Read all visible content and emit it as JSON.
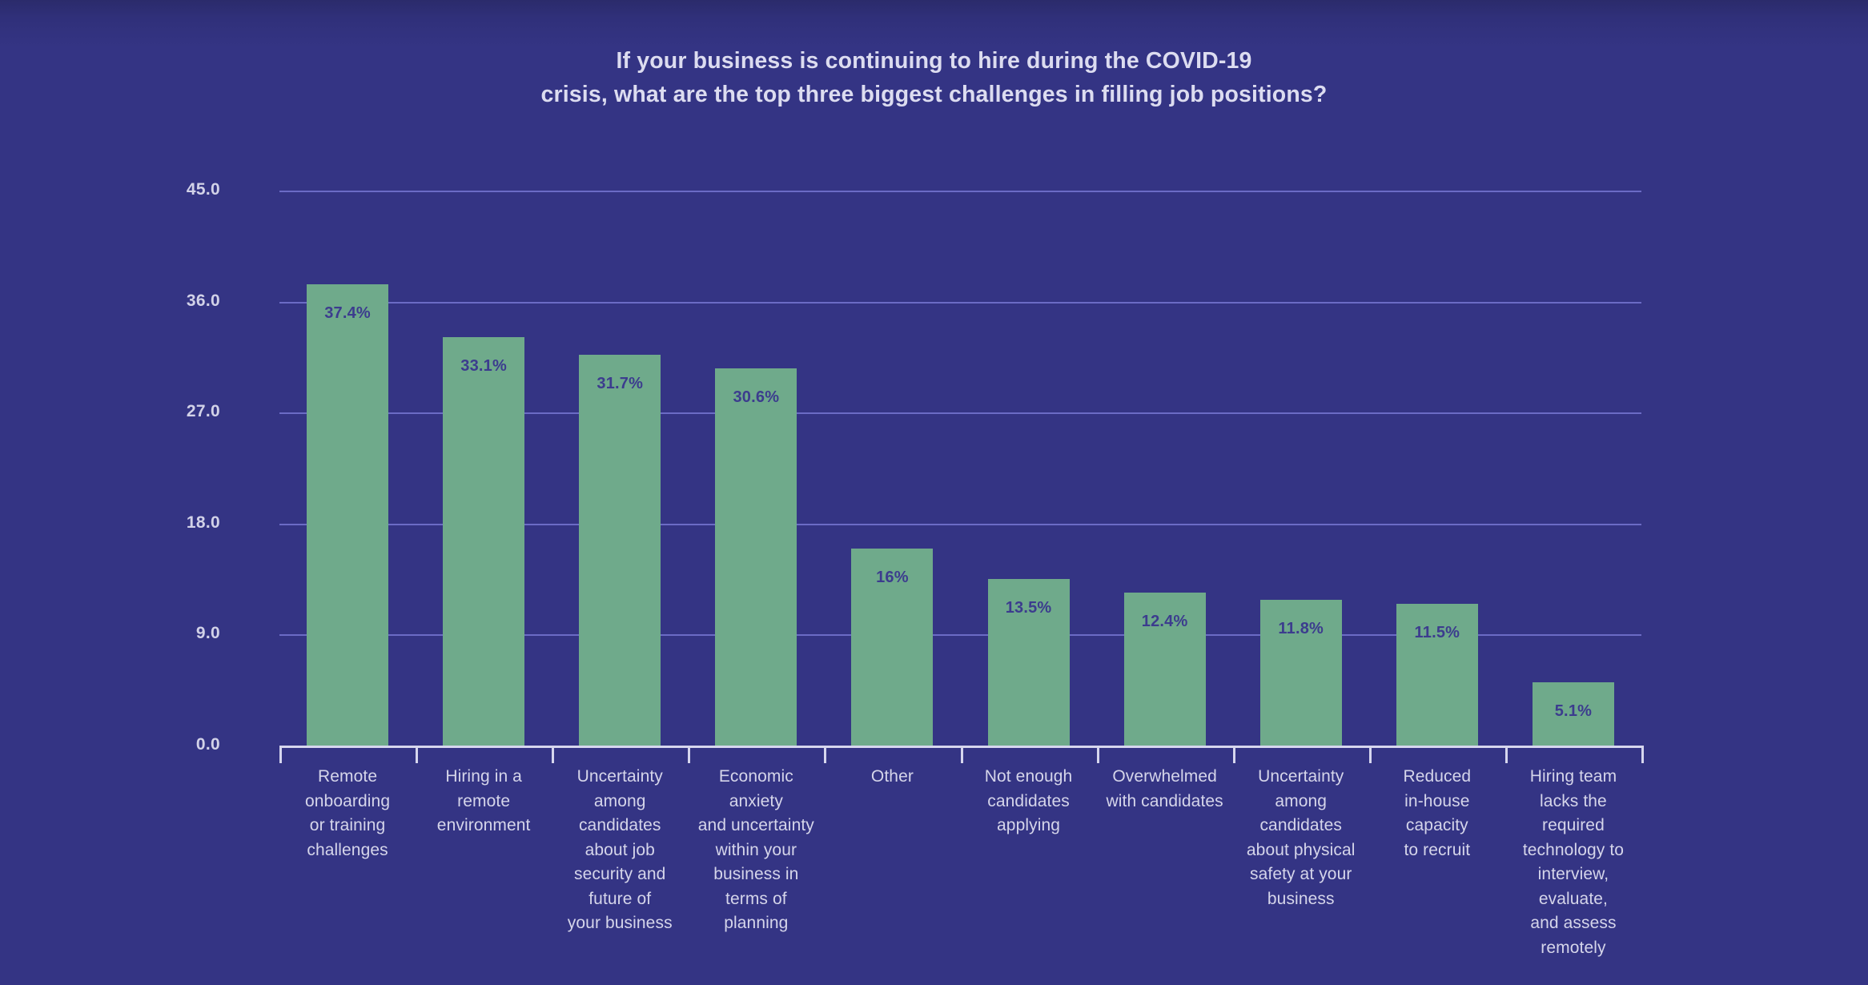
{
  "theme": {
    "background": "#343484",
    "background_top": "#2b2b6b",
    "bar_color": "#6faa8b",
    "gridline_color": "#6f6fc8",
    "axis_color": "#d6d6ee",
    "title_color": "#dcdcf0",
    "tick_label_color": "#d2d2e8",
    "value_label_color": "#3c3c8e"
  },
  "title": {
    "line1": "If your business is continuing to hire during the COVID-19",
    "line2": "crisis, what are the top three biggest challenges in filling job positions?"
  },
  "chart_data": {
    "type": "bar",
    "title": "If your business is continuing to hire during the COVID-19 crisis, what are the top three biggest challenges in filling job positions?",
    "xlabel": "",
    "ylabel": "",
    "ylim": [
      0,
      45
    ],
    "grid": true,
    "legend": "none",
    "y_ticks": [
      "0.0",
      "9.0",
      "18.0",
      "27.0",
      "36.0",
      "45.0"
    ],
    "y_tick_values": [
      0,
      9,
      18,
      27,
      36,
      45
    ],
    "categories": [
      "Remote onboarding or training challenges",
      "Hiring in a remote environment",
      "Uncertainty among candidates about job security and future of your business",
      "Economic anxiety and uncertainty within your business in terms of planning",
      "Other",
      "Not enough candidates applying",
      "Overwhelmed with candidates",
      "Uncertainty among candidates about physical safety at your business",
      "Reduced in-house capacity to recruit",
      "Hiring team lacks the required technology to interview, evaluate, and assess remotely"
    ],
    "category_lines": [
      [
        "Remote",
        "onboarding",
        "or training",
        "challenges"
      ],
      [
        "Hiring in a",
        "remote",
        "environment"
      ],
      [
        "Uncertainty",
        "among",
        "candidates",
        "about job",
        "security and",
        "future of",
        "your business"
      ],
      [
        "Economic",
        "anxiety",
        "and uncertainty",
        "within your",
        "business in",
        "terms of",
        "planning"
      ],
      [
        "Other"
      ],
      [
        "Not enough",
        "candidates",
        "applying"
      ],
      [
        "Overwhelmed",
        "with candidates"
      ],
      [
        "Uncertainty",
        "among",
        "candidates",
        "about physical",
        "safety at your",
        "business"
      ],
      [
        "Reduced",
        "in-house",
        "capacity",
        "to recruit"
      ],
      [
        "Hiring team",
        "lacks the",
        "required",
        "technology to",
        "interview, evaluate,",
        "and assess",
        "remotely"
      ]
    ],
    "values": [
      37.4,
      33.1,
      31.7,
      30.6,
      16.0,
      13.5,
      12.4,
      11.8,
      11.5,
      5.1
    ],
    "value_labels": [
      "37.4%",
      "33.1%",
      "31.7%",
      "30.6%",
      "16%",
      "13.5%",
      "12.4%",
      "11.8%",
      "11.5%",
      "5.1%"
    ]
  }
}
